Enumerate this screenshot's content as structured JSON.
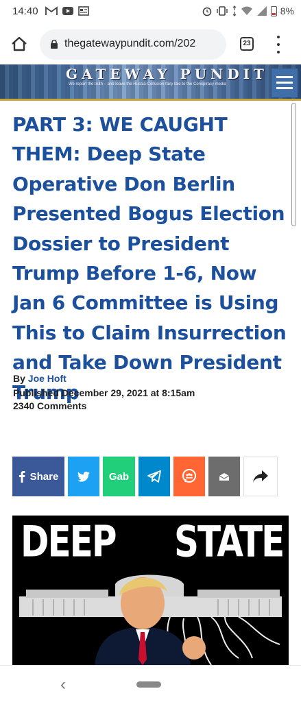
{
  "status_bar": {
    "time": "14:40",
    "battery": "8%"
  },
  "browser": {
    "url": "thegatewaypundit.com/202",
    "tab_count": "23"
  },
  "site_banner": {
    "title": "GATEWAY PUNDIT",
    "tagline": "We report the truth – and leave the Russia-Collusion fairy tale to the Conspiracy media"
  },
  "article": {
    "headline": "PART 3: WE CAUGHT THEM: Deep State Operative Don Berlin Presented Bogus Election Dossier to President Trump Before 1-6, Now Jan 6 Committee is Using This to Claim Insurrection and Take Down President Trump",
    "by_label": "By",
    "author": "Joe Hoft",
    "published": "Published December 29, 2021 at 8:15am",
    "comments": "2340 Comments"
  },
  "share_buttons": {
    "facebook_label": "Share",
    "gab_label": "Gab"
  },
  "featured_image": {
    "text_left": "DEEP",
    "text_right": "STATE"
  },
  "colors": {
    "headline": "#1c4f9c",
    "facebook": "#3b5998",
    "twitter": "#1da1f2",
    "gab": "#21cf7a",
    "telegram": "#0088cc",
    "mewe": "#ff6633",
    "email": "#6d6d6d"
  }
}
